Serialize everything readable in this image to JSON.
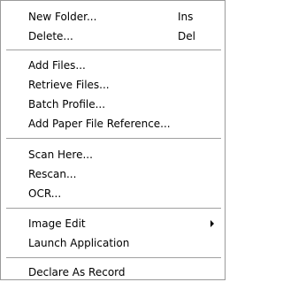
{
  "menu": {
    "items": [
      {
        "label": "New Folder...",
        "shortcut": "Ins"
      },
      {
        "label": "Delete...",
        "shortcut": "Del"
      },
      {
        "label": "Add Files..."
      },
      {
        "label": "Retrieve Files..."
      },
      {
        "label": "Batch Profile..."
      },
      {
        "label": "Add Paper File Reference..."
      },
      {
        "label": "Scan Here..."
      },
      {
        "label": "Rescan..."
      },
      {
        "label": "OCR..."
      },
      {
        "label": "Image Edit"
      },
      {
        "label": "Launch Application"
      },
      {
        "label": "Declare As Record"
      }
    ]
  }
}
